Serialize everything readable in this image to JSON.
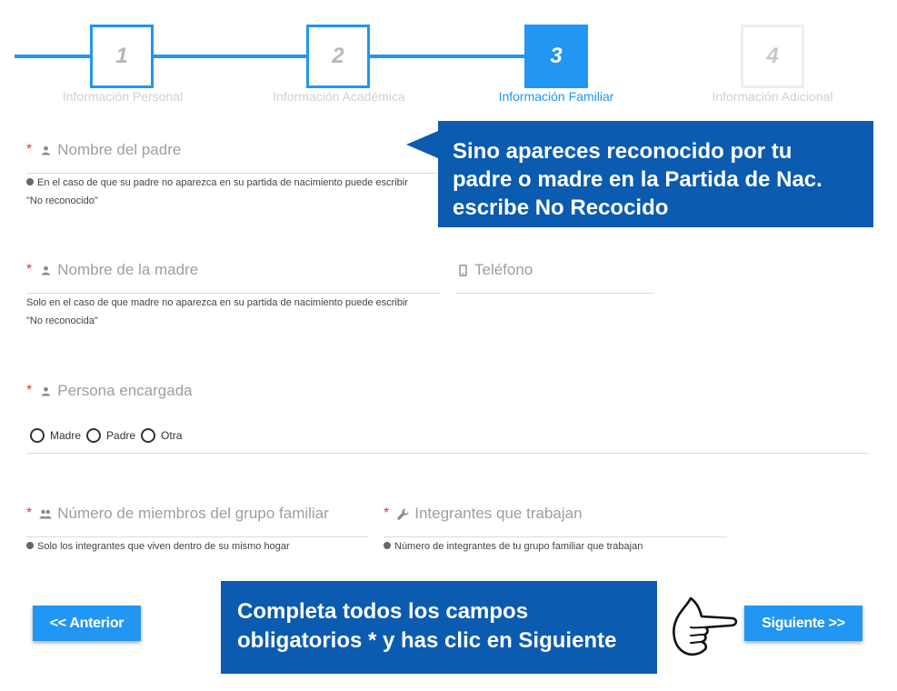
{
  "stepper": {
    "steps": [
      {
        "number": "1",
        "label": "Información Personal",
        "state": "done"
      },
      {
        "number": "2",
        "label": "Información Académica",
        "state": "done"
      },
      {
        "number": "3",
        "label": "Información Familiar",
        "state": "active"
      },
      {
        "number": "4",
        "label": "Información Adicional",
        "state": "pending"
      }
    ]
  },
  "form": {
    "required_mark": "*",
    "father": {
      "label": "Nombre del padre",
      "icon": "person-icon",
      "help": "En el caso de que su padre no aparezca en su partida de nacimiento puede escribir",
      "help2": "\"No reconocido\""
    },
    "mother": {
      "label": "Nombre de la madre",
      "icon": "person-icon",
      "help": "Solo en el caso de que madre no aparezca en su partida de nacimiento puede escribir",
      "help2": "\"No reconocida\""
    },
    "phone": {
      "label": "Teléfono",
      "icon": "phone-icon"
    },
    "guardian": {
      "label": "Persona encargada",
      "icon": "person-icon",
      "options": [
        "Madre",
        "Padre",
        "Otra"
      ]
    },
    "members": {
      "label": "Número de miembros del grupo familiar",
      "icon": "group-icon",
      "help": "Solo los integrantes que viven dentro de su mismo hogar"
    },
    "workers": {
      "label": "Integrantes que trabajan",
      "icon": "wrench-icon",
      "help": "Número de integrantes de tu grupo familiar que trabajan"
    }
  },
  "callouts": {
    "top": {
      "line1": "Sino apareces reconocido por tu",
      "line2": "padre o madre en la Partida de Nac.",
      "line3": "escribe No Recocido"
    },
    "bottom": {
      "line1": "Completa todos los campos",
      "line2": "obligatorios * y has clic en Siguiente"
    }
  },
  "nav": {
    "prev_label": "<< Anterior",
    "next_label": "Siguiente >>"
  },
  "colors": {
    "accent": "#2196f3",
    "callout": "#0b5bb0",
    "required": "#e53935"
  }
}
